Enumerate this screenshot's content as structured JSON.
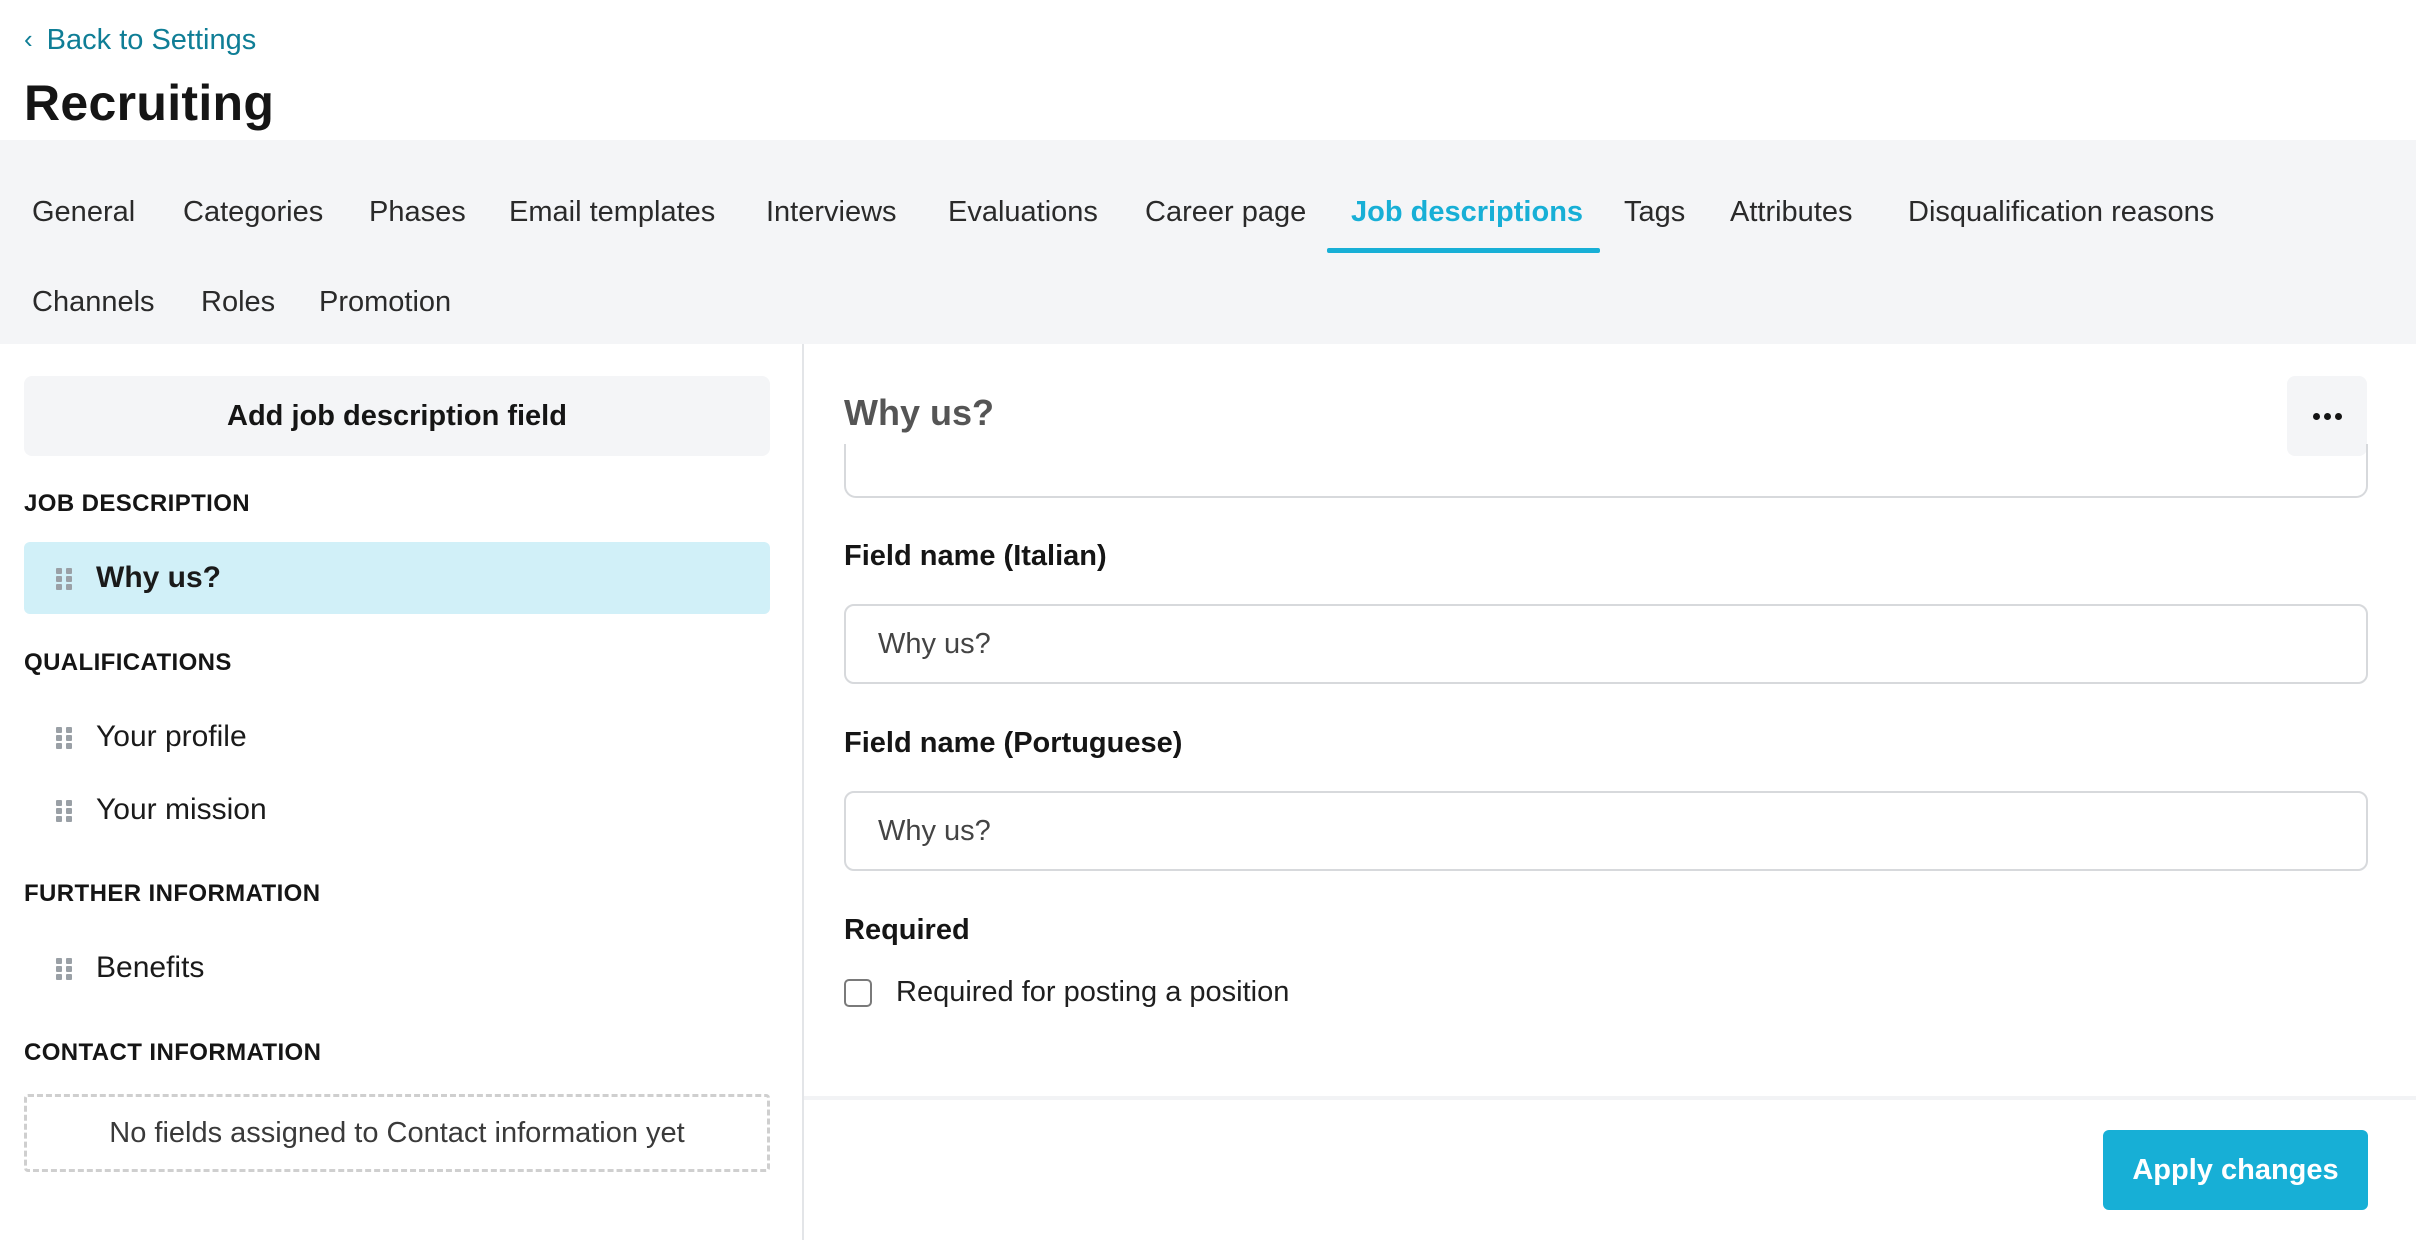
{
  "header": {
    "back_label": "Back to Settings",
    "back_icon": "chevron-left-icon",
    "title": "Recruiting"
  },
  "tabs": [
    {
      "label": "General",
      "active": false
    },
    {
      "label": "Categories",
      "active": false
    },
    {
      "label": "Phases",
      "active": false
    },
    {
      "label": "Email templates",
      "active": false
    },
    {
      "label": "Interviews",
      "active": false
    },
    {
      "label": "Evaluations",
      "active": false
    },
    {
      "label": "Career page",
      "active": false
    },
    {
      "label": "Job descriptions",
      "active": true
    },
    {
      "label": "Tags",
      "active": false
    },
    {
      "label": "Attributes",
      "active": false
    },
    {
      "label": "Disqualification reasons",
      "active": false
    },
    {
      "label": "Channels",
      "active": false
    },
    {
      "label": "Roles",
      "active": false
    },
    {
      "label": "Promotion",
      "active": false
    }
  ],
  "sidebar": {
    "add_button_label": "Add job description field",
    "sections": [
      {
        "title": "JOB DESCRIPTION",
        "items": [
          {
            "label": "Why us?",
            "selected": true
          }
        ]
      },
      {
        "title": "QUALIFICATIONS",
        "items": [
          {
            "label": "Your profile",
            "selected": false
          },
          {
            "label": "Your mission",
            "selected": false
          }
        ]
      },
      {
        "title": "FURTHER INFORMATION",
        "items": [
          {
            "label": "Benefits",
            "selected": false
          }
        ]
      },
      {
        "title": "CONTACT INFORMATION",
        "items": [],
        "empty_text": "No fields assigned to Contact information yet"
      }
    ]
  },
  "detail": {
    "title": "Why us?",
    "more_icon": "more-horizontal-icon",
    "fields": [
      {
        "label": "Field name (Italian)",
        "value": "Why us?"
      },
      {
        "label": "Field name (Portuguese)",
        "value": "Why us?"
      }
    ],
    "required_label": "Required",
    "required_checkbox_label": "Required for posting a position",
    "required_checked": false,
    "apply_label": "Apply changes"
  },
  "colors": {
    "accent": "#17afd6",
    "link": "#0f7e96",
    "selected_bg": "#d1f0f8",
    "tab_bar_bg": "#f4f5f7"
  }
}
